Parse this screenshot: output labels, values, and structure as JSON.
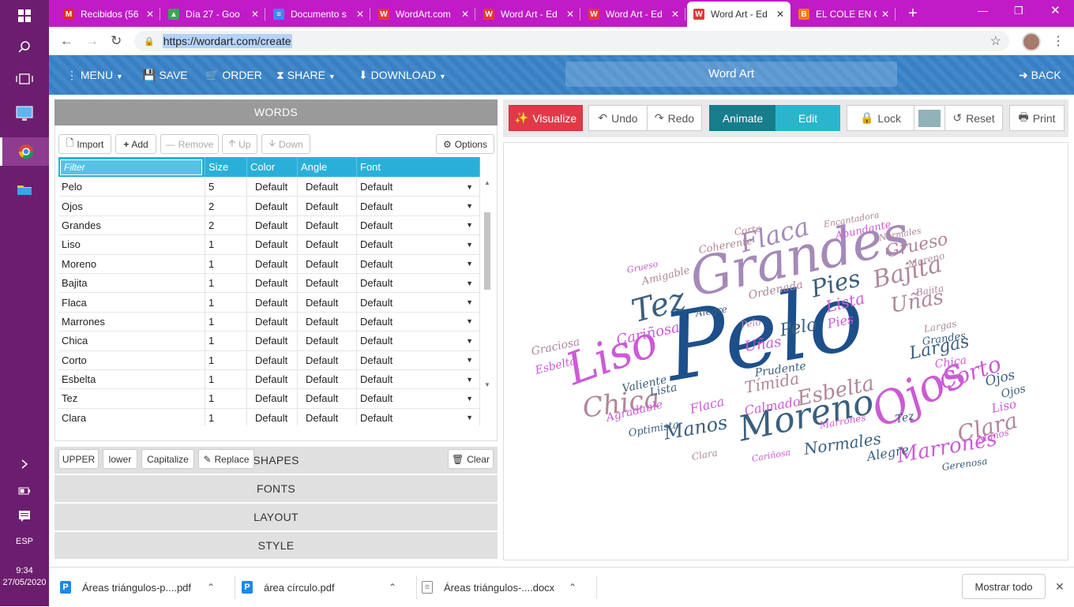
{
  "os": {
    "language": "ESP",
    "time": "9:34",
    "date": "27/05/2020"
  },
  "browser": {
    "tabs": [
      {
        "title": "Recibidos (56",
        "favicon": "gmail-icon",
        "color": "#d93025",
        "letter": "M"
      },
      {
        "title": "Día 27 - Goo",
        "favicon": "drive-icon",
        "color": "#34a853",
        "letter": "▲"
      },
      {
        "title": "Documento s",
        "favicon": "docs-icon",
        "color": "#4285f4",
        "letter": "≡"
      },
      {
        "title": "WordArt.com",
        "favicon": "wordart-icon",
        "color": "#e53935",
        "letter": "W"
      },
      {
        "title": "Word Art - Ed",
        "favicon": "wordart-icon",
        "color": "#e53935",
        "letter": "W"
      },
      {
        "title": "Word Art - Ed",
        "favicon": "wordart-icon",
        "color": "#e53935",
        "letter": "W"
      },
      {
        "title": "Word Art - Ed",
        "favicon": "wordart-icon",
        "color": "#e53935",
        "letter": "W",
        "active": true
      },
      {
        "title": "EL COLE EN C",
        "favicon": "blogger-icon",
        "color": "#f57c00",
        "letter": "B"
      }
    ],
    "url": "https://wordart.com/create"
  },
  "appbar": {
    "menu": "MENU",
    "save": "SAVE",
    "order": "ORDER",
    "share": "SHARE",
    "download": "DOWNLOAD",
    "title": "Word Art",
    "back": "BACK"
  },
  "words_panel": {
    "header": "WORDS",
    "buttons": {
      "import": "Import",
      "add": "Add",
      "remove": "Remove",
      "up": "Up",
      "down": "Down",
      "options": "Options"
    },
    "filter_placeholder": "Filter",
    "columns": [
      "Size",
      "Color",
      "Angle",
      "Font"
    ],
    "rows": [
      {
        "word": "Pelo",
        "size": "5",
        "color": "Default",
        "angle": "Default",
        "font": "Default"
      },
      {
        "word": "Ojos",
        "size": "2",
        "color": "Default",
        "angle": "Default",
        "font": "Default"
      },
      {
        "word": "Grandes",
        "size": "2",
        "color": "Default",
        "angle": "Default",
        "font": "Default"
      },
      {
        "word": "Liso",
        "size": "1",
        "color": "Default",
        "angle": "Default",
        "font": "Default"
      },
      {
        "word": "Moreno",
        "size": "1",
        "color": "Default",
        "angle": "Default",
        "font": "Default"
      },
      {
        "word": "Bajita",
        "size": "1",
        "color": "Default",
        "angle": "Default",
        "font": "Default"
      },
      {
        "word": "Flaca",
        "size": "1",
        "color": "Default",
        "angle": "Default",
        "font": "Default"
      },
      {
        "word": "Marrones",
        "size": "1",
        "color": "Default",
        "angle": "Default",
        "font": "Default"
      },
      {
        "word": "Chica",
        "size": "1",
        "color": "Default",
        "angle": "Default",
        "font": "Default"
      },
      {
        "word": "Corto",
        "size": "1",
        "color": "Default",
        "angle": "Default",
        "font": "Default"
      },
      {
        "word": "Esbelta",
        "size": "1",
        "color": "Default",
        "angle": "Default",
        "font": "Default"
      },
      {
        "word": "Tez",
        "size": "1",
        "color": "Default",
        "angle": "Default",
        "font": "Default"
      },
      {
        "word": "Clara",
        "size": "1",
        "color": "Default",
        "angle": "Default",
        "font": "Default"
      }
    ],
    "case_buttons": {
      "upper": "UPPER",
      "lower": "lower",
      "capitalize": "Capitalize",
      "replace": "Replace",
      "clear": "Clear"
    }
  },
  "sections": [
    "SHAPES",
    "FONTS",
    "LAYOUT",
    "STYLE"
  ],
  "toolbar": {
    "visualize": "Visualize",
    "undo": "Undo",
    "redo": "Redo",
    "animate": "Animate",
    "edit": "Edit",
    "lock": "Lock",
    "reset": "Reset",
    "print": "Print",
    "swatch_color": "#8fb3b8"
  },
  "cloud_colors": {
    "navy": "#1d4f8a",
    "slate": "#3b5f7e",
    "magenta": "#cc5bd6",
    "rose": "#b0879a",
    "mauve": "#a58ab8",
    "grey": "#8f8f9a"
  },
  "cloud_words": [
    {
      "text": "Pelo",
      "color": "navy"
    },
    {
      "text": "Grandes",
      "color": "mauve"
    },
    {
      "text": "Ojos",
      "color": "magenta"
    },
    {
      "text": "Liso",
      "color": "magenta"
    },
    {
      "text": "Moreno",
      "color": "slate"
    },
    {
      "text": "Flaca",
      "color": "mauve"
    },
    {
      "text": "Bajita",
      "color": "rose"
    },
    {
      "text": "Chica",
      "color": "rose"
    },
    {
      "text": "Tez",
      "color": "slate"
    },
    {
      "text": "Pies",
      "color": "slate"
    },
    {
      "text": "Corto",
      "color": "magenta"
    },
    {
      "text": "Clara",
      "color": "rose"
    },
    {
      "text": "Esbelta",
      "color": "rose"
    },
    {
      "text": "Marrones",
      "color": "magenta"
    },
    {
      "text": "Manos",
      "color": "slate"
    },
    {
      "text": "Uñas",
      "color": "rose"
    },
    {
      "text": "Largas",
      "color": "slate"
    },
    {
      "text": "Tímida",
      "color": "rose"
    },
    {
      "text": "Grueso",
      "color": "rose"
    },
    {
      "text": "Lista",
      "color": "magenta"
    },
    {
      "text": "Normales",
      "color": "slate"
    },
    {
      "text": "Alegre",
      "color": "slate"
    },
    {
      "text": "Pelo",
      "color": "slate"
    },
    {
      "text": "Cariñosa",
      "color": "magenta"
    },
    {
      "text": "Calmado",
      "color": "magenta"
    },
    {
      "text": "Prudente",
      "color": "slate"
    },
    {
      "text": "Valiente",
      "color": "slate"
    },
    {
      "text": "Agradable",
      "color": "magenta"
    },
    {
      "text": "Flaca",
      "color": "magenta"
    },
    {
      "text": "Optimista",
      "color": "slate"
    },
    {
      "text": "Graciosa",
      "color": "rose"
    },
    {
      "text": "Esbelta",
      "color": "magenta"
    },
    {
      "text": "Coherente",
      "color": "rose"
    },
    {
      "text": "Abundante",
      "color": "magenta"
    },
    {
      "text": "Ordenada",
      "color": "rose"
    },
    {
      "text": "Amigable",
      "color": "rose"
    },
    {
      "text": "Chica",
      "color": "magenta"
    },
    {
      "text": "Grandes",
      "color": "slate"
    },
    {
      "text": "Pies",
      "color": "magenta"
    },
    {
      "text": "Ojos",
      "color": "slate"
    },
    {
      "text": "Liso",
      "color": "magenta"
    },
    {
      "text": "Tez",
      "color": "slate"
    },
    {
      "text": "Alegre",
      "color": "slate"
    },
    {
      "text": "Gerenosa",
      "color": "slate"
    },
    {
      "text": "Corto",
      "color": "rose"
    },
    {
      "text": "Clara",
      "color": "rose"
    },
    {
      "text": "Encantadora",
      "color": "rose"
    },
    {
      "text": "Normales",
      "color": "rose"
    },
    {
      "text": "Moreno",
      "color": "rose"
    },
    {
      "text": "Uñas",
      "color": "magenta"
    },
    {
      "text": "Lista",
      "color": "slate"
    },
    {
      "text": "Marrones",
      "color": "magenta"
    },
    {
      "text": "Ojos",
      "color": "slate"
    },
    {
      "text": "Manos",
      "color": "magenta"
    },
    {
      "text": "Cariñosa",
      "color": "magenta"
    },
    {
      "text": "Bajita",
      "color": "rose"
    },
    {
      "text": "Pelo",
      "color": "rose"
    },
    {
      "text": "Largas",
      "color": "rose"
    },
    {
      "text": "Grueso",
      "color": "magenta"
    }
  ],
  "downloads": {
    "items": [
      {
        "name": "Áreas triángulos-p....pdf",
        "icon": "pdf-icon"
      },
      {
        "name": "área círculo.pdf",
        "icon": "pdf-icon"
      },
      {
        "name": "Áreas triángulos-....docx",
        "icon": "doc-icon"
      }
    ],
    "show_all": "Mostrar todo"
  }
}
